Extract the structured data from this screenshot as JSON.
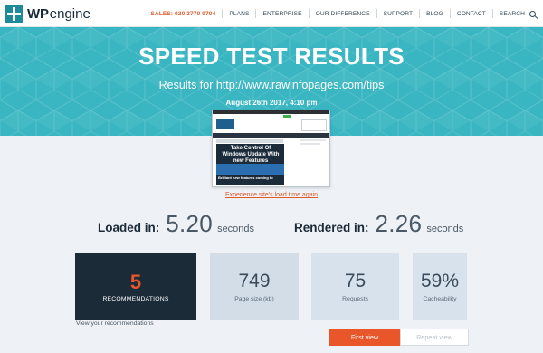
{
  "brand": {
    "logo_bold": "WP",
    "logo_light": "engine"
  },
  "nav": {
    "sales": "SALES: 020 3770 9704",
    "items": [
      "PLANS",
      "ENTERPRISE",
      "OUR DIFFERENCE",
      "SUPPORT",
      "BLOG",
      "CONTACT",
      "SEARCH"
    ],
    "search_icon": "search-icon"
  },
  "hero": {
    "title": "SPEED TEST RESULTS",
    "url_line": "Results for http://www.rawinfopages.com/tips",
    "date": "August 26th 2017, 4:10 pm"
  },
  "thumbnail": {
    "headline": "Take Control Of Windows Update With new Features",
    "subline": "Brilliant new features coming to"
  },
  "experience_link": "Experience site's load time again",
  "metrics": {
    "loaded_label": "Loaded in:",
    "loaded_value": "5.20",
    "loaded_unit": "seconds",
    "rendered_label": "Rendered in:",
    "rendered_value": "2.26",
    "rendered_unit": "seconds"
  },
  "cards": {
    "recommendations_value": "5",
    "recommendations_label": "RECOMMENDATIONS",
    "page_size_value": "749",
    "page_size_label": "Page size (kb)",
    "requests_value": "75",
    "requests_label": "Requests",
    "cacheability_value": "59%",
    "cacheability_label": "Cacheability"
  },
  "view_recommendations": "View your recommendations",
  "buttons": {
    "first_view": "First view",
    "repeat_view": "Repeat view"
  },
  "colors": {
    "accent": "#e9562a",
    "hero": "#3ab6c2",
    "dark": "#1c2b38"
  }
}
